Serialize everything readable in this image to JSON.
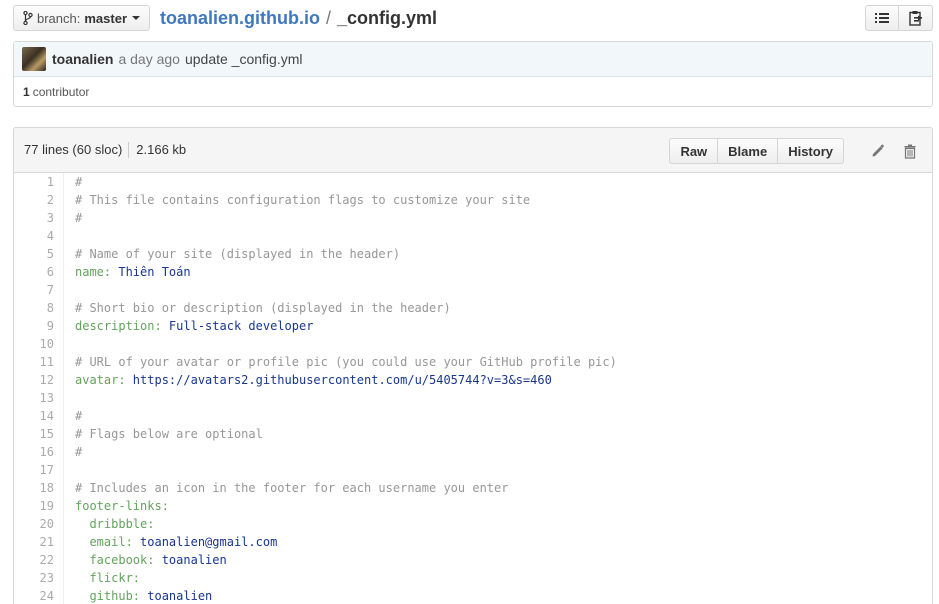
{
  "branch": {
    "label": "branch:",
    "value": "master"
  },
  "breadcrumb": {
    "repo": "toanalien.github.io",
    "separator": "/",
    "file": "_config.yml"
  },
  "commit": {
    "author": "toanalien",
    "time": "a day ago",
    "message": "update _config.yml",
    "contributors_count": "1",
    "contributors_label": "contributor"
  },
  "file": {
    "lines_info": "77 lines (60 sloc)",
    "size": "2.166 kb",
    "actions": {
      "raw": "Raw",
      "blame": "Blame",
      "history": "History"
    }
  },
  "code_lines": [
    {
      "n": "1",
      "parts": [
        {
          "t": "#",
          "c": "cm"
        }
      ]
    },
    {
      "n": "2",
      "parts": [
        {
          "t": "# This file contains configuration flags to customize your site",
          "c": "cm"
        }
      ]
    },
    {
      "n": "3",
      "parts": [
        {
          "t": "#",
          "c": "cm"
        }
      ]
    },
    {
      "n": "4",
      "parts": []
    },
    {
      "n": "5",
      "parts": [
        {
          "t": "# Name of your site (displayed in the header)",
          "c": "cm"
        }
      ]
    },
    {
      "n": "6",
      "parts": [
        {
          "t": "name:",
          "c": "ky"
        },
        {
          "t": " Thiên Toán",
          "c": "vl"
        }
      ]
    },
    {
      "n": "7",
      "parts": []
    },
    {
      "n": "8",
      "parts": [
        {
          "t": "# Short bio or description (displayed in the header)",
          "c": "cm"
        }
      ]
    },
    {
      "n": "9",
      "parts": [
        {
          "t": "description:",
          "c": "ky"
        },
        {
          "t": " Full-stack developer",
          "c": "vl"
        }
      ]
    },
    {
      "n": "10",
      "parts": []
    },
    {
      "n": "11",
      "parts": [
        {
          "t": "# URL of your avatar or profile pic (you could use your GitHub profile pic)",
          "c": "cm"
        }
      ]
    },
    {
      "n": "12",
      "parts": [
        {
          "t": "avatar:",
          "c": "ky"
        },
        {
          "t": " https://avatars2.githubusercontent.com/u/5405744?v=3&s=460",
          "c": "vl"
        }
      ]
    },
    {
      "n": "13",
      "parts": []
    },
    {
      "n": "14",
      "parts": [
        {
          "t": "#",
          "c": "cm"
        }
      ]
    },
    {
      "n": "15",
      "parts": [
        {
          "t": "# Flags below are optional",
          "c": "cm"
        }
      ]
    },
    {
      "n": "16",
      "parts": [
        {
          "t": "#",
          "c": "cm"
        }
      ]
    },
    {
      "n": "17",
      "parts": []
    },
    {
      "n": "18",
      "parts": [
        {
          "t": "# Includes an icon in the footer for each username you enter",
          "c": "cm"
        }
      ]
    },
    {
      "n": "19",
      "parts": [
        {
          "t": "footer-links:",
          "c": "ky"
        }
      ]
    },
    {
      "n": "20",
      "parts": [
        {
          "t": "  dribbble:",
          "c": "ky"
        }
      ]
    },
    {
      "n": "21",
      "parts": [
        {
          "t": "  email:",
          "c": "ky"
        },
        {
          "t": " toanalien@gmail.com",
          "c": "vl"
        }
      ]
    },
    {
      "n": "22",
      "parts": [
        {
          "t": "  facebook:",
          "c": "ky"
        },
        {
          "t": " toanalien",
          "c": "vl"
        }
      ]
    },
    {
      "n": "23",
      "parts": [
        {
          "t": "  flickr:",
          "c": "ky"
        }
      ]
    },
    {
      "n": "24",
      "parts": [
        {
          "t": "  github:",
          "c": "ky"
        },
        {
          "t": " toanalien",
          "c": "vl"
        }
      ]
    }
  ],
  "icons": {
    "branch": "git-branch-icon",
    "list": "list-icon",
    "clipboard": "clipboard-icon",
    "edit": "pencil-icon",
    "delete": "trash-icon"
  },
  "colors": {
    "link": "#4078c0",
    "comment": "#969896",
    "key": "#63a35c",
    "value": "#183691",
    "commit_bg": "#f2f8fa"
  }
}
